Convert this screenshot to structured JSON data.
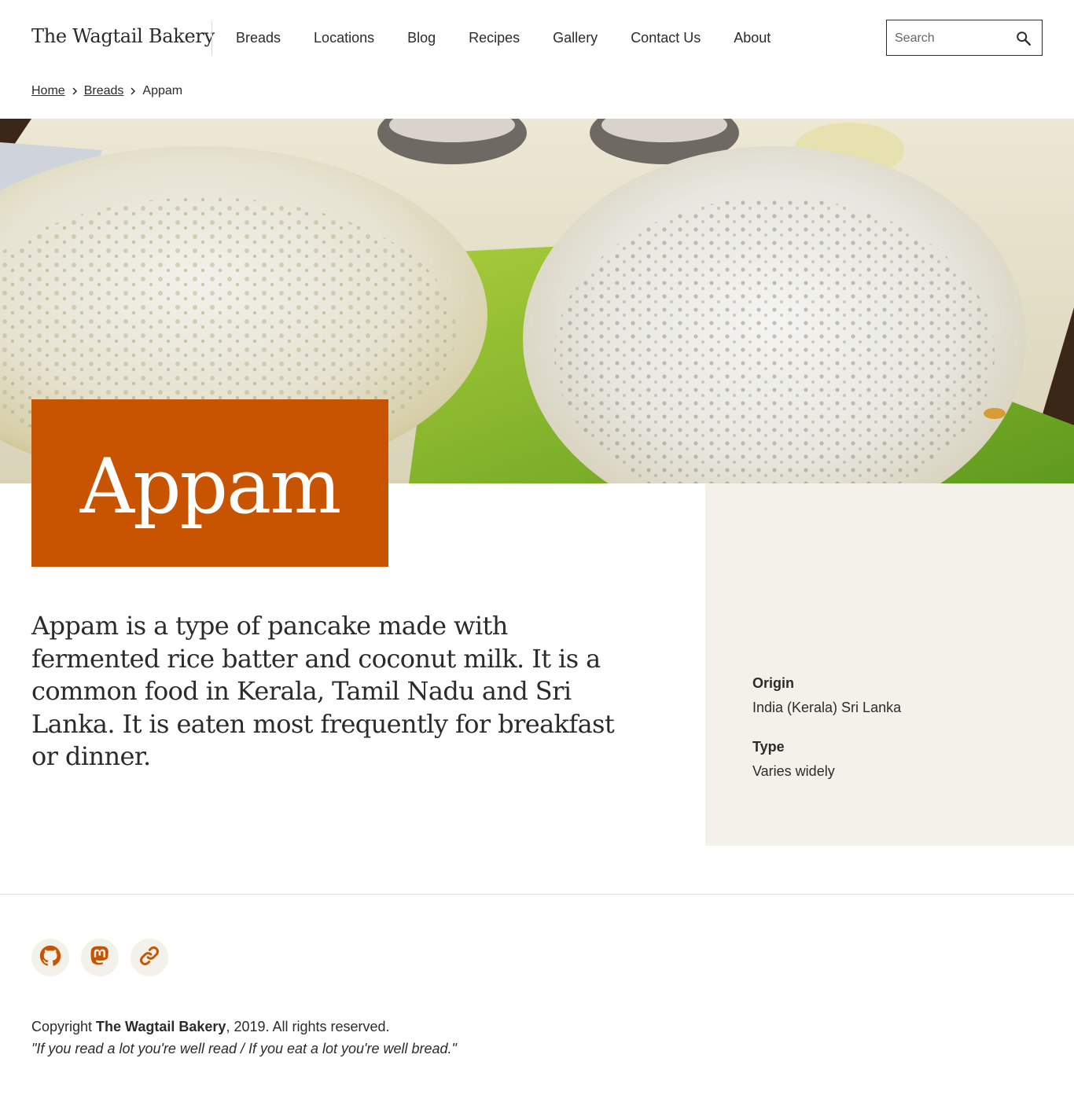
{
  "site": {
    "name": "The Wagtail Bakery"
  },
  "nav": {
    "items": [
      "Breads",
      "Locations",
      "Blog",
      "Recipes",
      "Gallery",
      "Contact Us",
      "About"
    ]
  },
  "search": {
    "placeholder": "Search",
    "icon": "search-icon"
  },
  "breadcrumb": {
    "home": "Home",
    "section": "Breads",
    "current": "Appam"
  },
  "page": {
    "title": "Appam",
    "intro": "Appam is a type of pancake made with fermented rice batter and coconut milk. It is a common food in Kerala, Tamil Nadu and Sri Lanka. It is eaten most frequently for breakfast or dinner."
  },
  "details": {
    "origin_label": "Origin",
    "origin_value": "India (Kerala) Sri Lanka",
    "type_label": "Type",
    "type_value": "Varies widely"
  },
  "footer": {
    "socials": [
      "github-icon",
      "mastodon-icon",
      "link-icon"
    ],
    "copyright_prefix": "Copyright ",
    "copyright_name": "The Wagtail Bakery",
    "copyright_suffix": ", 2019. All rights reserved.",
    "quote": "\"If you read a lot you're well read / If you eat a lot you're well bread.\""
  },
  "colors": {
    "accent": "#c85300",
    "sidebar_bg": "#f4f1ea",
    "text": "#2b2b2b"
  }
}
